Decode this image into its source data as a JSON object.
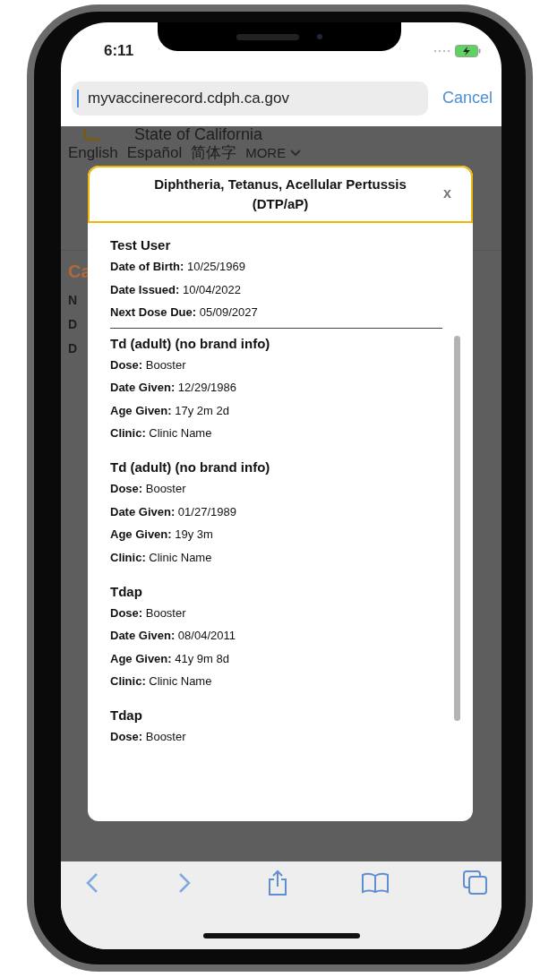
{
  "status_bar": {
    "time": "6:11"
  },
  "browser": {
    "url": "myvaccinerecord.cdph.ca.gov",
    "cancel": "Cancel"
  },
  "page_behind": {
    "site_name": "State of California",
    "languages": [
      "English",
      "Español",
      "简体字"
    ],
    "more": "MORE",
    "heading_fragment": "Ca",
    "label_fragments": [
      "N",
      "D",
      "D"
    ]
  },
  "modal": {
    "title": "Diphtheria, Tetanus, Acellular Pertussis (DTP/aP)",
    "close": "x",
    "patient": {
      "name": "Test User",
      "fields": [
        {
          "label": "Date of Birth:",
          "value": "10/25/1969"
        },
        {
          "label": "Date Issued:",
          "value": "10/04/2022"
        },
        {
          "label": "Next Dose Due:",
          "value": "05/09/2027"
        }
      ]
    },
    "doses": [
      {
        "name": "Td (adult) (no brand info)",
        "fields": [
          {
            "label": "Dose:",
            "value": "Booster"
          },
          {
            "label": "Date Given:",
            "value": "12/29/1986"
          },
          {
            "label": "Age Given:",
            "value": "17y 2m 2d"
          },
          {
            "label": "Clinic:",
            "value": "Clinic Name"
          }
        ]
      },
      {
        "name": "Td (adult) (no brand info)",
        "fields": [
          {
            "label": "Dose:",
            "value": "Booster"
          },
          {
            "label": "Date Given:",
            "value": "01/27/1989"
          },
          {
            "label": "Age Given:",
            "value": "19y 3m"
          },
          {
            "label": "Clinic:",
            "value": "Clinic Name"
          }
        ]
      },
      {
        "name": "Tdap",
        "fields": [
          {
            "label": "Dose:",
            "value": "Booster"
          },
          {
            "label": "Date Given:",
            "value": "08/04/2011"
          },
          {
            "label": "Age Given:",
            "value": "41y 9m 8d"
          },
          {
            "label": "Clinic:",
            "value": "Clinic Name"
          }
        ]
      },
      {
        "name": "Tdap",
        "fields": [
          {
            "label": "Dose:",
            "value": "Booster"
          }
        ]
      }
    ]
  }
}
